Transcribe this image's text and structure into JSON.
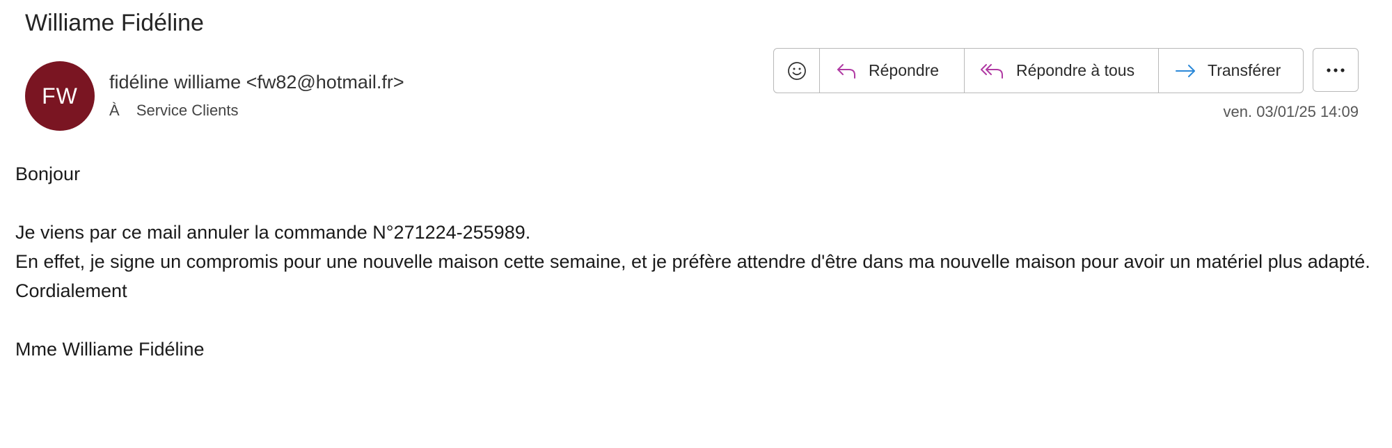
{
  "colors": {
    "avatar_bg": "#7a1522",
    "reply_icon": "#b03aa3",
    "reply_all_icon": "#b03aa3",
    "forward_icon": "#2b88d8"
  },
  "email": {
    "subject": "Williame Fidéline",
    "avatar_initials": "FW",
    "sender": "fidéline williame <fw82@hotmail.fr>",
    "to_prefix": "À",
    "recipient": "Service Clients",
    "timestamp": "ven. 03/01/25 14:09"
  },
  "actions": {
    "emoji_icon": "smiley-icon",
    "reply_label": "Répondre",
    "reply_all_label": "Répondre à tous",
    "forward_label": "Transférer",
    "more_icon": "ellipsis-icon"
  },
  "body": {
    "greeting": "Bonjour",
    "line1": "Je viens par ce mail annuler la commande N°271224-255989.",
    "line2": "En effet, je signe un compromis pour une nouvelle maison cette semaine, et je préfère attendre d'être dans ma nouvelle maison pour avoir un matériel plus adapté.",
    "closing": "Cordialement",
    "signature": "Mme Williame Fidéline"
  }
}
